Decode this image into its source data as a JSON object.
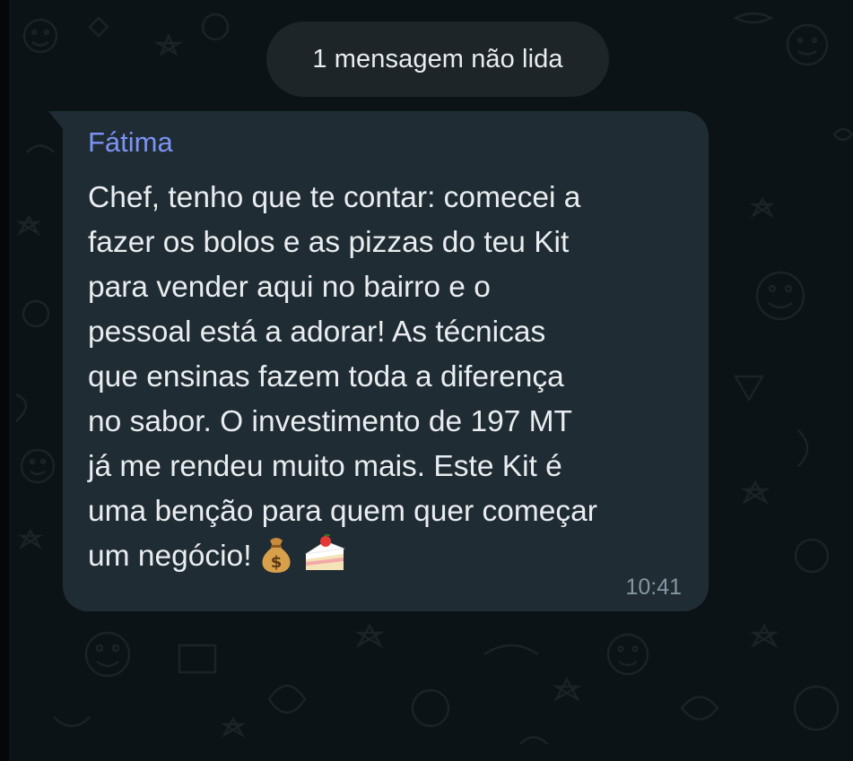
{
  "chat": {
    "unread_banner": "1 mensagem não lida"
  },
  "message": {
    "sender": "Fátima",
    "lines": [
      "Chef, tenho que te contar: comecei a",
      "fazer os bolos e as pizzas do teu Kit",
      "para vender aqui no bairro e o",
      "pessoal está a adorar! As técnicas",
      "que ensinas fazem toda a diferença",
      "no sabor. O investimento de 197 MT",
      "já me rendeu muito mais. Este Kit é",
      "uma benção para quem quer começar",
      "um negócio!"
    ],
    "emojis": [
      "money-bag-icon",
      "shortcake-icon"
    ],
    "time": "10:41"
  },
  "colors": {
    "background": "#0c1317",
    "bubble": "#202c33",
    "banner": "#1d2529",
    "sender_name": "#7b93f5",
    "text": "#e9edef",
    "timestamp": "#8696a0"
  }
}
